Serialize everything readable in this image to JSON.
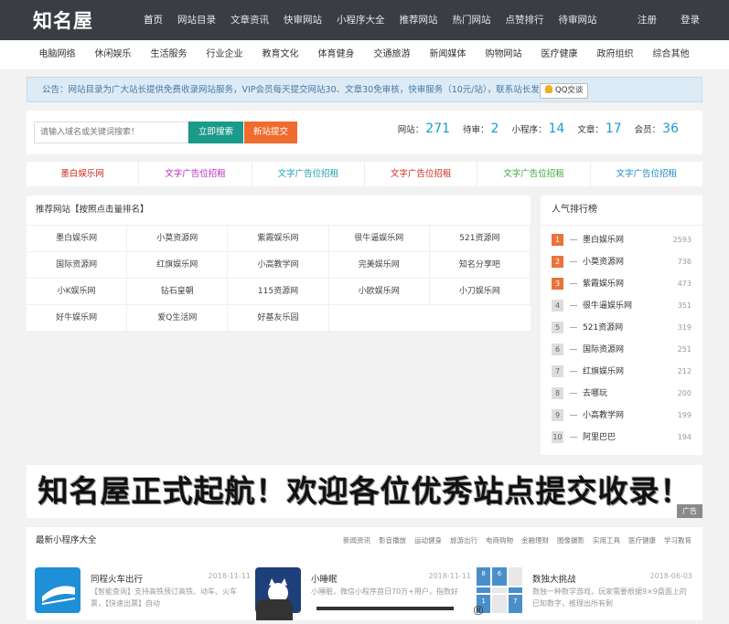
{
  "header": {
    "logo": "知名屋",
    "nav": [
      "首页",
      "网站目录",
      "文章资讯",
      "快审网站",
      "小程序大全",
      "推荐网站",
      "热门网站",
      "点赞排行",
      "待审网站"
    ],
    "register": "注册",
    "login": "登录"
  },
  "categories": [
    "电脑网络",
    "休闲娱乐",
    "生活服务",
    "行业企业",
    "教育文化",
    "体育健身",
    "交通旅游",
    "新闻媒体",
    "购物网站",
    "医疗健康",
    "政府组织",
    "综合其他"
  ],
  "notice": {
    "text": "公告：网站目录为广大站长提供免费收录网站服务，VIP会员每天提交网站30、文章30免审核，快审服务（10元/站），联系站长发布。",
    "qq_button": "QQ交谈"
  },
  "search": {
    "placeholder": "请输入域名或关键词搜索！",
    "search_button": "立即搜索",
    "submit_button": "新站提交",
    "stats": [
      {
        "label": "网站：",
        "value": "271"
      },
      {
        "label": "待审：",
        "value": "2"
      },
      {
        "label": "小程序：",
        "value": "14"
      },
      {
        "label": "文章：",
        "value": "17"
      },
      {
        "label": "会员：",
        "value": "36"
      }
    ]
  },
  "ad_links": [
    {
      "text": "墨白娱乐网",
      "color": "#d0281e"
    },
    {
      "text": "文字广告位招租",
      "color": "#c026c8"
    },
    {
      "text": "文字广告位招租",
      "color": "#1aa0b0"
    },
    {
      "text": "文字广告位招租",
      "color": "#d0281e"
    },
    {
      "text": "文字广告位招租",
      "color": "#3aa83a"
    },
    {
      "text": "文字广告位招租",
      "color": "#1a8cc8"
    }
  ],
  "recommended": {
    "title": "推荐网站【按照点击量排名】",
    "sites": [
      "墨白娱乐网",
      "小莫资源网",
      "紫霞娱乐网",
      "很牛逼娱乐网",
      "521资源网",
      "国际资源网",
      "红旗娱乐网",
      "小高教学网",
      "完美娱乐网",
      "知名分享吧",
      "小K娱乐网",
      "钻石皇朝",
      "115资源网",
      "小欧娱乐网",
      "小刀娱乐网",
      "好牛娱乐网",
      "爱Q生活网",
      "好基友乐园"
    ]
  },
  "ranking": {
    "title": "人气排行榜",
    "items": [
      {
        "rank": "1",
        "name": "墨白娱乐网",
        "count": "2593"
      },
      {
        "rank": "2",
        "name": "小莫资源网",
        "count": "736"
      },
      {
        "rank": "3",
        "name": "紫霞娱乐网",
        "count": "473"
      },
      {
        "rank": "4",
        "name": "很牛逼娱乐网",
        "count": "351"
      },
      {
        "rank": "5",
        "name": "521资源网",
        "count": "319"
      },
      {
        "rank": "6",
        "name": "国际资源网",
        "count": "251"
      },
      {
        "rank": "7",
        "name": "红旗娱乐网",
        "count": "212"
      },
      {
        "rank": "8",
        "name": "去哪玩",
        "count": "200"
      },
      {
        "rank": "9",
        "name": "小高教学网",
        "count": "199"
      },
      {
        "rank": "10",
        "name": "阿里巴巴",
        "count": "194"
      }
    ]
  },
  "banner": {
    "text": "知名屋正式起航！欢迎各位优秀站点提交收录！",
    "ad_tag": "广告"
  },
  "mini_programs": {
    "title": "最新小程序大全",
    "tabs": [
      "新闻资讯",
      "影音播放",
      "运动健身",
      "旅游出行",
      "电商购物",
      "金融理财",
      "图像摄影",
      "实用工具",
      "医疗健康",
      "学习教育"
    ],
    "cards": [
      {
        "name": "同程火车出行",
        "date": "2018-11-11",
        "desc": "【智能查询】支持高铁预订高铁、动车、火车票，【快速出票】自动",
        "icon_color": "#1f8fd8"
      },
      {
        "name": "小睡眠",
        "date": "2018-11-11",
        "desc": "小睡眠，微信小程序首日70万+用户，指数好",
        "icon_color": "#1d3f7a"
      },
      {
        "name": "数独大挑战",
        "date": "2018-06-03",
        "desc": "数独一种数学游戏，玩家需要根据9×9盘面上的已知数字，推理出所有剩",
        "icon_color": "#4a8fc9"
      }
    ],
    "sudoku_digits": [
      "8",
      "6",
      "",
      "",
      "",
      "",
      "1",
      "",
      "7"
    ]
  }
}
